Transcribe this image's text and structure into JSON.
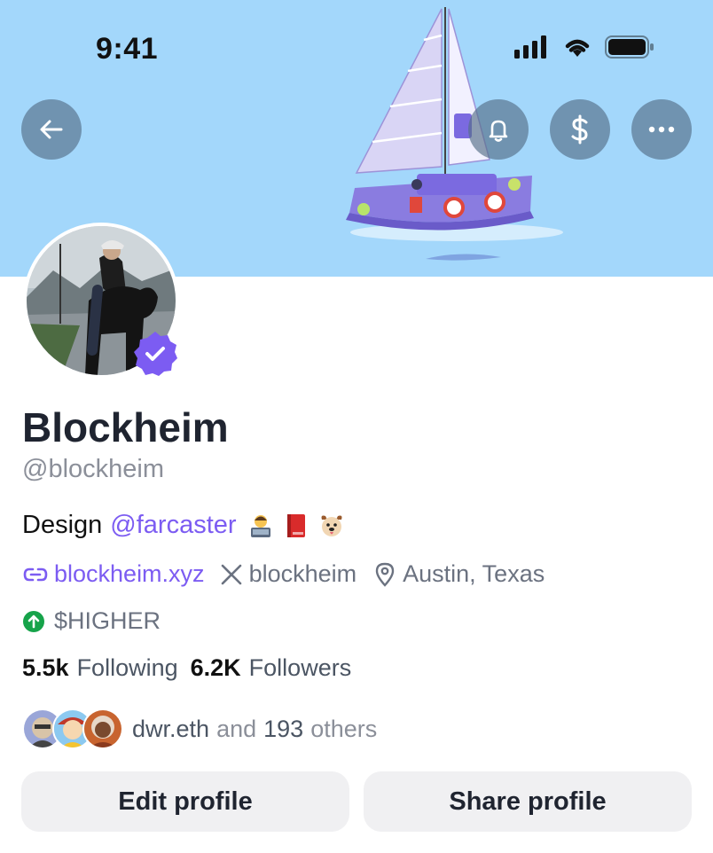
{
  "status_bar": {
    "time": "9:41",
    "signal_icon": "cellular-signal-icon",
    "wifi_icon": "wifi-icon",
    "battery_icon": "battery-icon"
  },
  "header": {
    "back_icon": "arrow-left-icon",
    "bell_icon": "bell-icon",
    "tip_icon": "dollar-icon",
    "more_icon": "ellipsis-icon",
    "banner_image": "sailboat-illustration",
    "banner_color": "#a3d7fb"
  },
  "profile": {
    "avatar": "rider-on-horse-photo",
    "verified_icon": "verified-badge-icon",
    "verified_color": "#7c5cf2",
    "name": "Blockheim",
    "handle": "@blockheim",
    "bio_prefix": "Design",
    "bio_mention": "@farcaster",
    "bio_emojis": [
      "technologist-emoji",
      "red-book-emoji",
      "dog-face-emoji"
    ],
    "website": "blockheim.xyz",
    "x_handle": "blockheim",
    "location": "Austin, Texas",
    "token": "$HIGHER",
    "token_color": "#16a34a"
  },
  "stats": {
    "following_count": "5.5k",
    "following_label": "Following",
    "followers_count": "6.2K",
    "followers_label": "Followers"
  },
  "mutuals": {
    "name": "dwr.eth",
    "and_text": "and",
    "count": "193",
    "others_text": "others"
  },
  "actions": {
    "edit_label": "Edit profile",
    "share_label": "Share profile"
  },
  "colors": {
    "accent": "#7c5cf2",
    "text_muted": "#8b8f99"
  }
}
